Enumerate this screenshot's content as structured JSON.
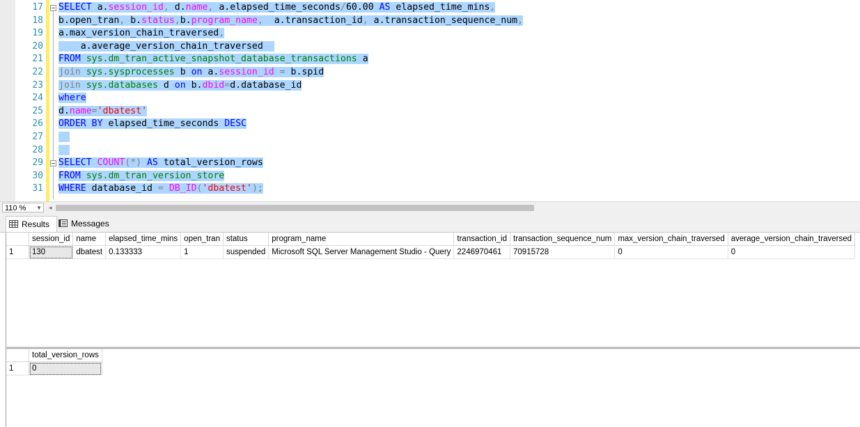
{
  "editor": {
    "lines": [
      {
        "num": "17",
        "tokens": [
          [
            "kw",
            "SELECT "
          ],
          [
            "plain",
            "a."
          ],
          [
            "fn",
            "session_id"
          ],
          [
            "op",
            ", "
          ],
          [
            "plain",
            "d."
          ],
          [
            "fn",
            "name"
          ],
          [
            "op",
            ", "
          ],
          [
            "plain",
            "a.elapsed_time_seconds"
          ],
          [
            "op",
            "/"
          ],
          [
            "plain",
            "60.00 "
          ],
          [
            "kw",
            "AS "
          ],
          [
            "plain",
            "elapsed_time_mins"
          ],
          [
            "op",
            ","
          ]
        ]
      },
      {
        "num": "18",
        "tokens": [
          [
            "plain",
            "b.open_tran"
          ],
          [
            "op",
            ", "
          ],
          [
            "plain",
            "b."
          ],
          [
            "fn",
            "status"
          ],
          [
            "op",
            ","
          ],
          [
            "plain",
            "b."
          ],
          [
            "fn",
            "program_name"
          ],
          [
            "op",
            ",  "
          ],
          [
            "plain",
            "a.transaction_id"
          ],
          [
            "op",
            ", "
          ],
          [
            "plain",
            "a.transaction_sequence_num"
          ],
          [
            "op",
            ","
          ]
        ]
      },
      {
        "num": "19",
        "tokens": [
          [
            "plain",
            "a.max_version_chain_traversed"
          ],
          [
            "op",
            ","
          ]
        ]
      },
      {
        "num": "20",
        "tokens": [
          [
            "plain",
            "    a.average_version_chain_traversed  "
          ]
        ]
      },
      {
        "num": "21",
        "tokens": [
          [
            "kw",
            "FROM "
          ],
          [
            "sys",
            "sys.dm_tran_active_snapshot_database_transactions "
          ],
          [
            "plain",
            "a"
          ]
        ]
      },
      {
        "num": "22",
        "tokens": [
          [
            "op",
            "join "
          ],
          [
            "sys",
            "sys.sysprocesses "
          ],
          [
            "plain",
            "b "
          ],
          [
            "kw",
            "on "
          ],
          [
            "plain",
            "a."
          ],
          [
            "fn",
            "session_id"
          ],
          [
            "op",
            " = "
          ],
          [
            "plain",
            "b.spid"
          ]
        ]
      },
      {
        "num": "23",
        "tokens": [
          [
            "op",
            "join "
          ],
          [
            "sys",
            "sys.databases "
          ],
          [
            "plain",
            "d "
          ],
          [
            "kw",
            "on "
          ],
          [
            "plain",
            "b."
          ],
          [
            "fn",
            "dbid"
          ],
          [
            "op",
            "="
          ],
          [
            "plain",
            "d.database_id"
          ]
        ]
      },
      {
        "num": "24",
        "tokens": [
          [
            "kw",
            "where"
          ]
        ]
      },
      {
        "num": "25",
        "tokens": [
          [
            "plain",
            "d."
          ],
          [
            "fn",
            "name"
          ],
          [
            "op",
            "="
          ],
          [
            "str",
            "'dbatest'"
          ]
        ]
      },
      {
        "num": "26",
        "tokens": [
          [
            "kw",
            "ORDER BY "
          ],
          [
            "plain",
            "elapsed_time_seconds "
          ],
          [
            "kw",
            "DESC"
          ]
        ]
      },
      {
        "num": "27",
        "tokens": [
          [
            "plain",
            "  "
          ]
        ]
      },
      {
        "num": "28",
        "tokens": [
          [
            "plain",
            "  "
          ]
        ]
      },
      {
        "num": "29",
        "tokens": [
          [
            "kw",
            "SELECT "
          ],
          [
            "fn",
            "COUNT"
          ],
          [
            "op",
            "(*) "
          ],
          [
            "kw",
            "AS "
          ],
          [
            "plain",
            "total_version_rows"
          ]
        ]
      },
      {
        "num": "30",
        "tokens": [
          [
            "kw",
            "FROM "
          ],
          [
            "sys",
            "sys.dm_tran_version_store"
          ]
        ]
      },
      {
        "num": "31",
        "tokens": [
          [
            "kw",
            "WHERE "
          ],
          [
            "plain",
            "database_id "
          ],
          [
            "op",
            "= "
          ],
          [
            "fn",
            "DB_ID"
          ],
          [
            "op",
            "("
          ],
          [
            "str",
            "'dbatest'"
          ],
          [
            "op",
            ");"
          ]
        ]
      }
    ]
  },
  "zoom": {
    "level": "110 %"
  },
  "tabs": {
    "results": "Results",
    "messages": "Messages"
  },
  "grid1": {
    "columns": [
      "session_id",
      "name",
      "elapsed_time_mins",
      "open_tran",
      "status",
      "program_name",
      "transaction_id",
      "transaction_sequence_num",
      "max_version_chain_traversed",
      "average_version_chain_traversed"
    ],
    "rows": [
      {
        "num": "1",
        "cells": [
          "130",
          "dbatest",
          "0.133333",
          "1",
          "suspended",
          "Microsoft SQL Server Management Studio - Query",
          "2246970461",
          "70915728",
          "0",
          "0"
        ]
      }
    ]
  },
  "grid2": {
    "columns": [
      "total_version_rows"
    ],
    "rows": [
      {
        "num": "1",
        "cells": [
          "0"
        ]
      }
    ]
  }
}
